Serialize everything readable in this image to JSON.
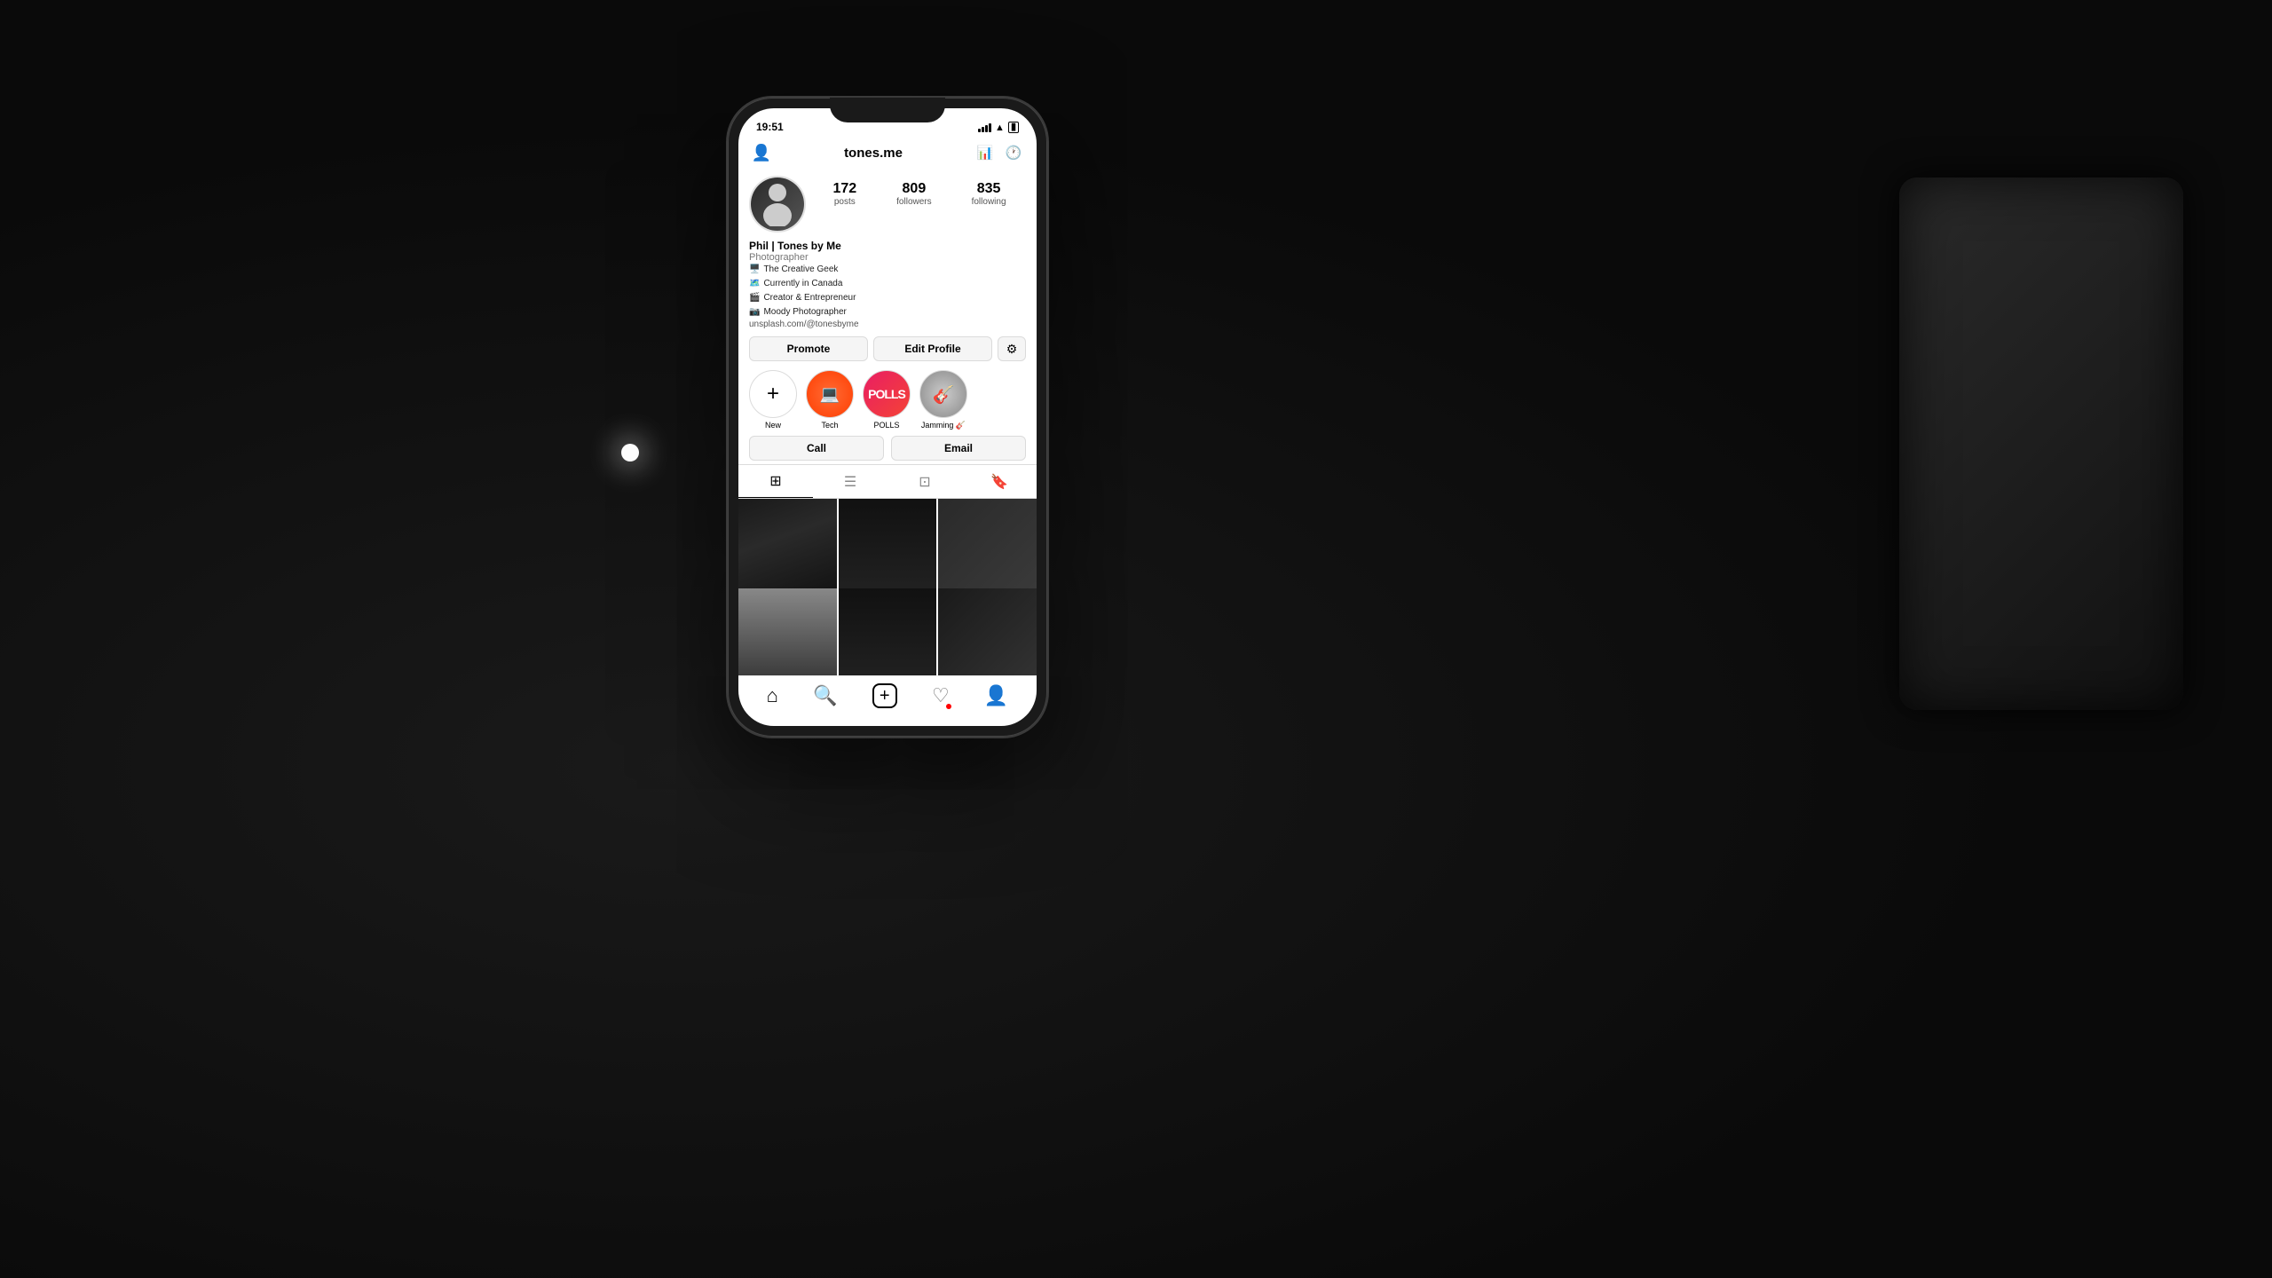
{
  "scene": {
    "background": "#0a0a0a"
  },
  "phone": {
    "status_bar": {
      "time": "19:51",
      "signal_label": "signal bars",
      "wifi_label": "wifi icon",
      "battery_label": "battery icon"
    },
    "header": {
      "username": "tones.me",
      "chart_icon": "chart-icon",
      "history_icon": "history-icon",
      "add_user_icon": "add-user-icon"
    },
    "stats": {
      "posts_count": "172",
      "posts_label": "posts",
      "followers_count": "809",
      "followers_label": "followers",
      "following_count": "835",
      "following_label": "following"
    },
    "profile": {
      "name": "Phil | Tones by Me",
      "role": "Photographer",
      "bio_line1": "The Creative Geek",
      "bio_line2": "Currently in Canada",
      "bio_line3": "Creator & Entrepreneur",
      "bio_line4": "Moody Photographer",
      "link": "unsplash.com/@tonesbyme"
    },
    "buttons": {
      "promote": "Promote",
      "edit_profile": "Edit Profile",
      "settings_icon": "settings-icon"
    },
    "highlights": [
      {
        "label": "New",
        "type": "new"
      },
      {
        "label": "Tech",
        "type": "story"
      },
      {
        "label": "POLLS",
        "type": "story"
      },
      {
        "label": "Jamming 🎸",
        "type": "story"
      }
    ],
    "contact": {
      "call": "Call",
      "email": "Email"
    },
    "tabs": [
      {
        "label": "grid-icon",
        "active": true
      },
      {
        "label": "list-icon",
        "active": false
      },
      {
        "label": "tag-icon",
        "active": false
      },
      {
        "label": "bookmark-icon",
        "active": false
      }
    ],
    "nav": {
      "home_icon": "home-icon",
      "search_icon": "search-icon",
      "add_icon": "add-icon",
      "heart_icon": "heart-icon",
      "profile_icon": "profile-icon"
    }
  }
}
